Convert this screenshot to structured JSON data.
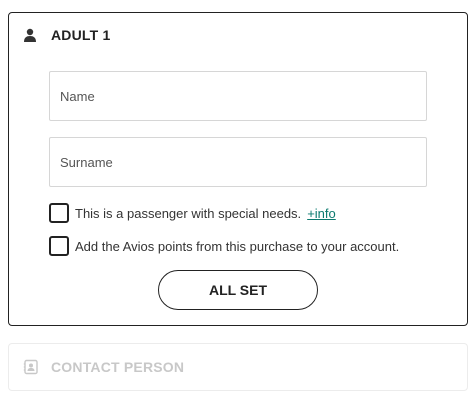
{
  "passenger": {
    "title": "ADULT 1",
    "icon": "person-icon",
    "name_placeholder": "Name",
    "name_value": "",
    "surname_placeholder": "Surname",
    "surname_value": "",
    "special_needs_label": "This is a passenger with special needs.",
    "special_needs_link": "+info",
    "special_needs_checked": false,
    "avios_label": "Add the Avios points from this purchase to your account.",
    "avios_checked": false,
    "submit_label": "ALL SET"
  },
  "contact": {
    "title": "CONTACT PERSON",
    "icon": "contact-card-icon",
    "state": "disabled"
  },
  "colors": {
    "text": "#222222",
    "link": "#0b7a6f",
    "disabled_text": "#c8c8c8",
    "field_border": "#d6d6d6"
  }
}
